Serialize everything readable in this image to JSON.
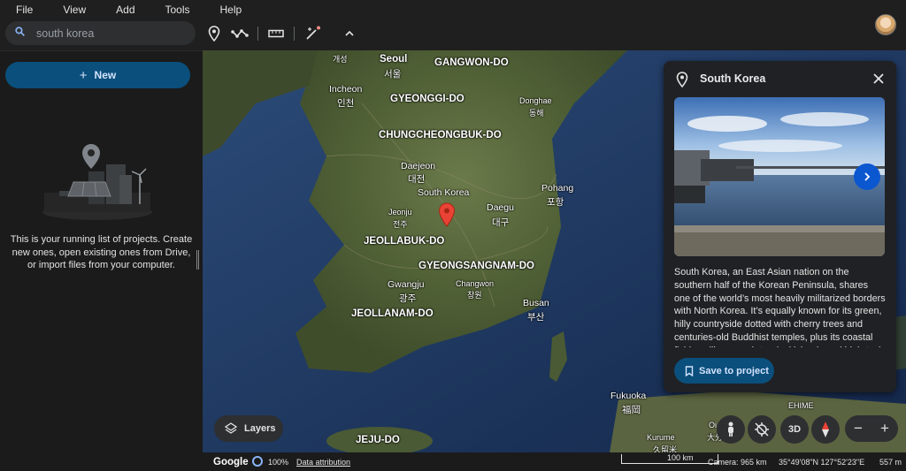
{
  "menu": [
    "File",
    "View",
    "Add",
    "Tools",
    "Help"
  ],
  "search": {
    "value": "south korea"
  },
  "sidebar": {
    "new_label": "New",
    "empty_text": "This is your running list of projects. Create new ones, open existing ones from Drive, or import files from your computer."
  },
  "map_labels": [
    {
      "text": "개성",
      "cls": "lbl-s"
    },
    {
      "text": "Seoul",
      "cls": "lbl-b"
    },
    {
      "text": "서울",
      "cls": ""
    },
    {
      "text": "GANGWON-DO",
      "cls": "lbl-b"
    },
    {
      "text": "Incheon",
      "cls": ""
    },
    {
      "text": "인천",
      "cls": ""
    },
    {
      "text": "GYEONGGI-DO",
      "cls": "lbl-b"
    },
    {
      "text": "Donghae",
      "cls": "lbl-s"
    },
    {
      "text": "동해",
      "cls": "lbl-s"
    },
    {
      "text": "CHUNGCHEONGBUK-DO",
      "cls": "lbl-b"
    },
    {
      "text": "Daejeon",
      "cls": ""
    },
    {
      "text": "대전",
      "cls": ""
    },
    {
      "text": "South Korea",
      "cls": ""
    },
    {
      "text": "Pohang",
      "cls": ""
    },
    {
      "text": "포항",
      "cls": ""
    },
    {
      "text": "Jeonju",
      "cls": "lbl-s"
    },
    {
      "text": "전주",
      "cls": "lbl-s"
    },
    {
      "text": "Daegu",
      "cls": ""
    },
    {
      "text": "대구",
      "cls": ""
    },
    {
      "text": "JEOLLABUK-DO",
      "cls": "lbl-b"
    },
    {
      "text": "GYEONGSANGNAM-DO",
      "cls": "lbl-b"
    },
    {
      "text": "Gwangju",
      "cls": ""
    },
    {
      "text": "광주",
      "cls": ""
    },
    {
      "text": "Changwon",
      "cls": "lbl-s"
    },
    {
      "text": "창원",
      "cls": "lbl-s"
    },
    {
      "text": "Busan",
      "cls": ""
    },
    {
      "text": "부산",
      "cls": ""
    },
    {
      "text": "JEOLLANAM-DO",
      "cls": "lbl-b"
    },
    {
      "text": "JEJU-DO",
      "cls": "lbl-b"
    },
    {
      "text": "Fukuoka",
      "cls": ""
    },
    {
      "text": "福岡",
      "cls": ""
    },
    {
      "text": "EHIME",
      "cls": "lbl-s"
    },
    {
      "text": "Kurume",
      "cls": "lbl-s"
    },
    {
      "text": "久留米",
      "cls": "lbl-s"
    },
    {
      "text": "Oi",
      "cls": "lbl-s"
    },
    {
      "text": "大分",
      "cls": "lbl-s"
    }
  ],
  "panel": {
    "title": "South Korea",
    "description": "South Korea, an East Asian nation on the southern half of the Korean Peninsula, shares one of the world’s most heavily militarized borders with North Korea. It’s equally known for its green, hilly countryside dotted with cherry trees and centuries-old Buddhist temples, plus its coastal fishing villages, sub-tropical islands and high-tech cities such as Seoul, the capital.",
    "save_label": "Save to project"
  },
  "layers_label": "Layers",
  "view_3d_label": "3D",
  "status": {
    "logo": "Google",
    "load_pct": "100%",
    "attribution": "Data attribution",
    "scale": "100 km",
    "camera": "Camera: 965 km",
    "coords": "35°49'08\"N 127°52'23\"E",
    "elevation": "557 m"
  },
  "colors": {
    "accent_button": "#0b4f7c",
    "accent_text": "#d3e3fd",
    "marker": "#ea4335",
    "next_button": "#0b57d0"
  }
}
